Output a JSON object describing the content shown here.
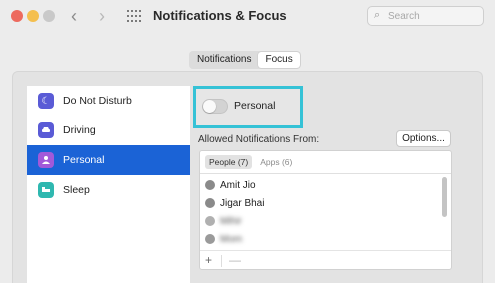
{
  "window": {
    "title": "Notifications & Focus",
    "search_placeholder": "Search"
  },
  "tabs": [
    {
      "label": "Notifications",
      "active": false
    },
    {
      "label": "Focus",
      "active": true
    }
  ],
  "sidebar": {
    "items": [
      {
        "label": "Do Not Disturb",
        "icon": "moon-icon",
        "color": "#5a5bd6",
        "selected": false
      },
      {
        "label": "Driving",
        "icon": "car-icon",
        "color": "#5a5bd6",
        "selected": false
      },
      {
        "label": "Personal",
        "icon": "person-icon",
        "color": "#a259d9",
        "selected": true
      },
      {
        "label": "Sleep",
        "icon": "bed-icon",
        "color": "#2fb8b0",
        "selected": false
      }
    ]
  },
  "focus": {
    "name": "Personal",
    "toggle_on": false,
    "allowed_label": "Allowed Notifications From:",
    "options_label": "Options...",
    "list_tabs": [
      {
        "label": "People (7)",
        "active": true
      },
      {
        "label": "Apps (6)",
        "active": false
      }
    ],
    "people": [
      {
        "name": "Amit Jio",
        "blurred_part": true
      },
      {
        "name": "Jigar Bhai",
        "blurred_part": true
      },
      {
        "name": "Mihir",
        "blurred_part": true
      },
      {
        "name": "Mom",
        "blurred_part": true
      }
    ],
    "add_label": "+",
    "remove_label": "—"
  },
  "colors": {
    "selection": "#1b63d6",
    "highlight_border": "#35c2d6"
  }
}
